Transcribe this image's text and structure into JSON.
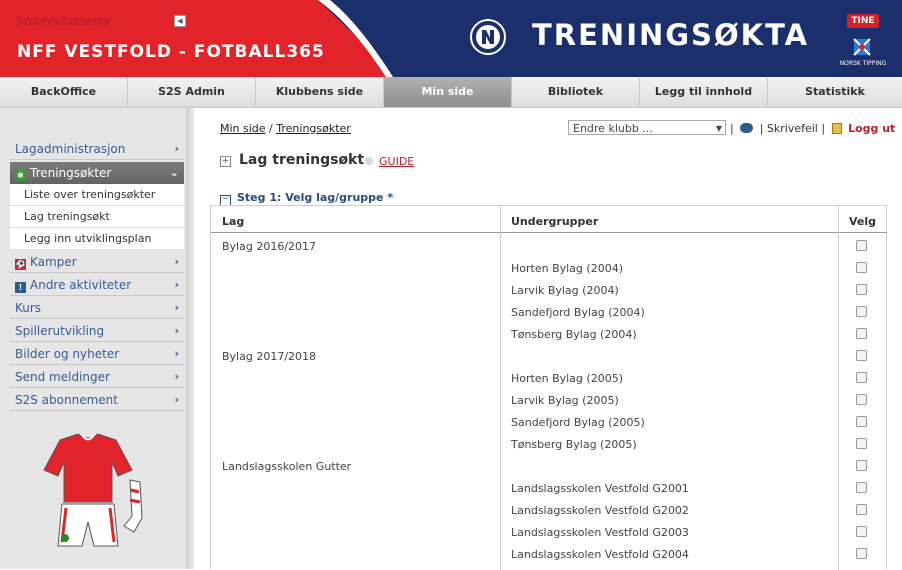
{
  "header": {
    "brand": "NFF VESTFOLD - FOTBALL365",
    "title": "TRENINGSØKTA",
    "sponsor_tine": "TINE",
    "sponsor_nt": "NORSK TIPPING"
  },
  "topnav": [
    {
      "label": "BackOffice"
    },
    {
      "label": "S2S Admin"
    },
    {
      "label": "Klubbens side"
    },
    {
      "label": "Min side"
    },
    {
      "label": "Bibliotek"
    },
    {
      "label": "Legg til innhold"
    },
    {
      "label": "Statistikk"
    }
  ],
  "sidebar": {
    "heading": "Snarveismeny",
    "items": {
      "lagadmin": "Lagadministrasjon",
      "treningsokter": "Treningsøkter",
      "kamper": "Kamper",
      "andre": "Andre aktiviteter",
      "kurs": "Kurs",
      "spillerutvikling": "Spillerutvikling",
      "bilder": "Bilder og nyheter",
      "meldinger": "Send meldinger",
      "s2s": "S2S abonnement"
    },
    "sub": {
      "liste": "Liste over treningsøkter",
      "lag": "Lag treningsøkt",
      "utvikling": "Legg inn utviklingsplan"
    }
  },
  "breadcrumb": {
    "root": "Min side",
    "sep": " / ",
    "current": "Treningsøkter"
  },
  "club_select": "Endre klubb ...",
  "tools": {
    "skrivefeil": "Skrivefeil",
    "logout": "Logg ut"
  },
  "page_title": "Lag treningsøkt",
  "guide_label": "GUIDE",
  "step_label": "Steg 1: Velg lag/gruppe *",
  "table": {
    "columns": {
      "lag": "Lag",
      "undergrupper": "Undergrupper",
      "velg": "Velg"
    },
    "rows": {
      "r0": {
        "lag": "Bylag 2016/2017",
        "sub": ""
      },
      "r1": {
        "lag": "",
        "sub": "Horten Bylag (2004)"
      },
      "r2": {
        "lag": "",
        "sub": "Larvik Bylag (2004)"
      },
      "r3": {
        "lag": "",
        "sub": "Sandefjord Bylag (2004)"
      },
      "r4": {
        "lag": "",
        "sub": "Tønsberg Bylag (2004)"
      },
      "r5": {
        "lag": "Bylag 2017/2018",
        "sub": ""
      },
      "r6": {
        "lag": "",
        "sub": "Horten Bylag (2005)"
      },
      "r7": {
        "lag": "",
        "sub": "Larvik Bylag (2005)"
      },
      "r8": {
        "lag": "",
        "sub": "Sandefjord Bylag (2005)"
      },
      "r9": {
        "lag": "",
        "sub": "Tønsberg Bylag (2005)"
      },
      "r10": {
        "lag": "Landslagsskolen Gutter",
        "sub": ""
      },
      "r11": {
        "lag": "",
        "sub": "Landslagsskolen Vestfold G2001"
      },
      "r12": {
        "lag": "",
        "sub": "Landslagsskolen Vestfold G2002"
      },
      "r13": {
        "lag": "",
        "sub": "Landslagsskolen Vestfold G2003"
      },
      "r14": {
        "lag": "",
        "sub": "Landslagsskolen Vestfold G2004"
      }
    }
  },
  "colors": {
    "brand_red": "#e2232a",
    "navy": "#1a2f6b",
    "link_blue": "#3a5a94"
  }
}
